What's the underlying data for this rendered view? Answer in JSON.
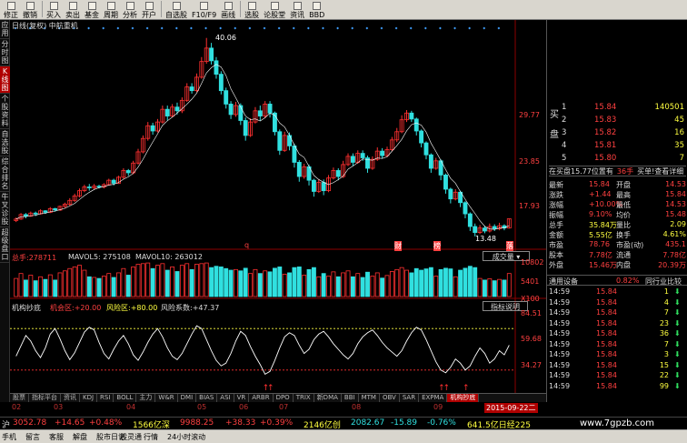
{
  "toolbar": [
    "修正",
    "撤销",
    "买入",
    "卖出",
    "基金",
    "周期",
    "分析",
    "开户",
    "自选股",
    "F10/F9",
    "画线",
    "选股",
    "论股堂",
    "资讯",
    "BBD"
  ],
  "sidebar": [
    "应用",
    "分时图",
    "K线图",
    "个股资料",
    "自选股",
    "综合排名",
    "牛叉诊股",
    "超级盘口"
  ],
  "chart": {
    "title": "日线(复权)",
    "stock": "中航重机",
    "price_labels": [
      "29.77",
      "23.85",
      "17.93"
    ],
    "max_label": "40.06",
    "min_label": "13.48",
    "events": [
      "q",
      "财",
      "榜",
      "落"
    ],
    "volume_label": "总手:278711",
    "mavol5": "MAVOL5: 275108",
    "mavol10": "MAVOL10: 263012",
    "chip_tab": "成交量",
    "vol_axis": [
      "10802",
      "5401",
      "X100"
    ],
    "ind_name": "机构抄底",
    "ind_p1": "机会区:+20.00",
    "ind_p2": "风险区:+80.00",
    "ind_p3": "风险系数:+47.37",
    "ind_btn": "指标说明",
    "ind_axis": [
      "84.51",
      "59.68",
      "34.27"
    ],
    "months": [
      "02",
      "03",
      "04",
      "05",
      "06",
      "07",
      "08",
      "09"
    ],
    "date_box": "2015-09-22二"
  },
  "tabs": [
    "股票",
    "指标平台",
    "资讯",
    "KDJ",
    "RSI",
    "BOLL",
    "主力",
    "W&R",
    "DMI",
    "BIAS",
    "ASI",
    "VR",
    "ARBR",
    "DPO",
    "TRIX",
    "新DMA",
    "BBI",
    "MTM",
    "OBV",
    "SAR",
    "EXPMA",
    "机构抄底"
  ],
  "orderbook": {
    "sell_tag": "卖",
    "buy_tag": "买",
    "sell_label": "盘",
    "asks": [
      {
        "n": "1",
        "p": "15.84",
        "v": "140501"
      },
      {
        "n": "2",
        "p": "15.83",
        "v": "45"
      },
      {
        "n": "3",
        "p": "15.82",
        "v": "16"
      },
      {
        "n": "4",
        "p": "15.81",
        "v": "35"
      },
      {
        "n": "5",
        "p": "15.80",
        "v": "7"
      }
    ],
    "note": "在买盘15.77位置有",
    "note_v": "36手",
    "note_link": "买单!查看详细"
  },
  "stats": [
    [
      "最新",
      "15.84",
      "开盘",
      "14.53"
    ],
    [
      "涨跌",
      "+1.44",
      "最高",
      "15.84"
    ],
    [
      "涨幅",
      "+10.00%",
      "最低",
      "14.53"
    ],
    [
      "振幅",
      "9.10%",
      "均价",
      "15.48"
    ],
    [
      "总手",
      "35.84万",
      "量比",
      "2.09"
    ],
    [
      "金额",
      "5.55亿",
      "换手",
      "4.61%"
    ],
    [
      "市盈",
      "78.76",
      "市盈(动)",
      "435.1"
    ],
    [
      "股本",
      "7.78亿",
      "流通",
      "7.78亿"
    ],
    [
      "外盘",
      "15.46万",
      "内盘",
      "20.39万"
    ]
  ],
  "tabs2": {
    "a": "通用设备",
    "b": "0.82%",
    "c": "同行业比较"
  },
  "trades": [
    [
      "14:59",
      "15.84",
      "1"
    ],
    [
      "14:59",
      "15.84",
      "4"
    ],
    [
      "14:59",
      "15.84",
      "7"
    ],
    [
      "14:59",
      "15.84",
      "23"
    ],
    [
      "14:59",
      "15.84",
      "36"
    ],
    [
      "14:59",
      "15.84",
      "7"
    ],
    [
      "14:59",
      "15.84",
      "3"
    ],
    [
      "14:59",
      "15.84",
      "15"
    ],
    [
      "14:59",
      "15.84",
      "22"
    ],
    [
      "14:59",
      "15.84",
      "99"
    ]
  ],
  "index": {
    "a": "沪",
    "b": "3052.78",
    "c": "+14.65",
    "d": "+0.48%",
    "e": "1566亿深",
    "f": "9988.25",
    "g": "+38.33",
    "h": "+0.39%",
    "i": "2146亿创",
    "j": "2082.67",
    "k": "-15.89",
    "l": "-0.76%",
    "m": "641.5亿日经225"
  },
  "status": [
    "手机",
    "留言",
    "客服",
    "解盘",
    "股市日记",
    "股灵通",
    "行情",
    "24小时滚动"
  ],
  "watermark": "www.7gpzb.com",
  "colors": {
    "up": "#ff3030",
    "down": "#30e0e0",
    "yellow": "#ffff40"
  },
  "chart_data": {
    "type": "candlestick",
    "price_range": [
      12,
      41
    ],
    "candles": [
      [
        15.6,
        15.8,
        15.4,
        16.0
      ],
      [
        15.8,
        16.4,
        15.7,
        16.6
      ],
      [
        16.4,
        16.2,
        15.9,
        16.6
      ],
      [
        16.2,
        16.6,
        16.1,
        16.8
      ],
      [
        16.6,
        16.5,
        16.2,
        16.8
      ],
      [
        16.5,
        16.9,
        16.4,
        17.1
      ],
      [
        16.9,
        16.7,
        16.5,
        17.0
      ],
      [
        16.7,
        17.2,
        16.6,
        17.4
      ],
      [
        17.2,
        17.0,
        16.8,
        17.3
      ],
      [
        17.0,
        17.5,
        16.9,
        17.6
      ],
      [
        17.5,
        17.8,
        17.3,
        18.0
      ],
      [
        17.8,
        18.3,
        17.6,
        18.6
      ],
      [
        18.3,
        18.9,
        18.1,
        19.2
      ],
      [
        18.9,
        19.6,
        18.7,
        19.9
      ],
      [
        19.6,
        20.1,
        19.4,
        20.4
      ],
      [
        20.1,
        20.0,
        19.6,
        20.5
      ],
      [
        20.0,
        20.2,
        19.8,
        20.5
      ],
      [
        20.2,
        20.1,
        19.9,
        20.4
      ],
      [
        20.1,
        20.4,
        19.9,
        20.6
      ],
      [
        20.4,
        21.0,
        20.3,
        21.2
      ],
      [
        21.0,
        20.6,
        20.3,
        21.2
      ],
      [
        20.6,
        21.4,
        20.5,
        21.6
      ],
      [
        21.4,
        22.3,
        21.2,
        22.6
      ],
      [
        22.3,
        22.0,
        21.6,
        22.5
      ],
      [
        22.0,
        23.3,
        21.8,
        23.6
      ],
      [
        23.3,
        24.8,
        23.1,
        25.2
      ],
      [
        24.8,
        26.6,
        24.6,
        27.0
      ],
      [
        26.6,
        28.3,
        26.3,
        28.8
      ],
      [
        28.3,
        27.6,
        27.1,
        28.7
      ],
      [
        27.6,
        28.8,
        27.4,
        29.2
      ],
      [
        28.8,
        30.5,
        28.6,
        31.0
      ],
      [
        30.5,
        29.6,
        29.0,
        31.0
      ],
      [
        29.6,
        30.8,
        29.4,
        31.2
      ],
      [
        30.8,
        30.3,
        29.8,
        31.4
      ],
      [
        30.3,
        31.7,
        30.0,
        32.1
      ],
      [
        31.7,
        33.5,
        31.5,
        34.0
      ],
      [
        33.5,
        33.0,
        32.6,
        34.0
      ],
      [
        33.0,
        34.8,
        32.8,
        35.3
      ],
      [
        34.8,
        36.9,
        34.6,
        37.5
      ],
      [
        36.9,
        38.7,
        36.6,
        40.06
      ],
      [
        38.7,
        37.0,
        36.5,
        39.4
      ],
      [
        37.0,
        35.2,
        34.6,
        37.5
      ],
      [
        35.2,
        33.0,
        32.5,
        35.6
      ],
      [
        33.0,
        31.2,
        30.6,
        33.4
      ],
      [
        31.2,
        29.8,
        29.2,
        31.6
      ],
      [
        29.8,
        31.0,
        29.5,
        31.5
      ],
      [
        31.0,
        29.0,
        28.4,
        31.3
      ],
      [
        29.0,
        27.0,
        26.3,
        29.4
      ],
      [
        27.0,
        28.8,
        26.8,
        29.3
      ],
      [
        28.8,
        30.3,
        28.6,
        30.8
      ],
      [
        30.3,
        29.6,
        29.0,
        31.0
      ],
      [
        29.6,
        31.2,
        29.3,
        31.6
      ],
      [
        31.2,
        30.0,
        29.4,
        31.6
      ],
      [
        30.0,
        27.5,
        27.0,
        30.2
      ],
      [
        27.5,
        25.0,
        24.4,
        27.8
      ],
      [
        25.0,
        27.0,
        24.8,
        27.5
      ],
      [
        27.0,
        25.6,
        25.0,
        27.4
      ],
      [
        25.6,
        23.4,
        22.7,
        25.9
      ],
      [
        23.4,
        21.5,
        20.8,
        23.7
      ],
      [
        21.5,
        22.8,
        21.2,
        23.2
      ],
      [
        22.8,
        21.0,
        20.3,
        23.1
      ],
      [
        21.0,
        19.5,
        18.8,
        21.2
      ],
      [
        19.5,
        20.7,
        19.3,
        21.1
      ],
      [
        20.7,
        19.6,
        19.0,
        21.1
      ],
      [
        19.6,
        21.3,
        19.4,
        21.7
      ],
      [
        21.3,
        22.3,
        21.1,
        22.7
      ],
      [
        22.3,
        21.5,
        21.0,
        22.6
      ],
      [
        21.5,
        23.1,
        21.3,
        23.6
      ],
      [
        23.1,
        24.2,
        22.9,
        24.6
      ],
      [
        24.2,
        23.4,
        22.9,
        24.6
      ],
      [
        23.4,
        24.6,
        23.2,
        25.0
      ],
      [
        24.6,
        24.0,
        23.6,
        25.0
      ],
      [
        24.0,
        22.6,
        22.0,
        24.3
      ],
      [
        22.6,
        23.8,
        22.4,
        24.2
      ],
      [
        23.8,
        24.9,
        23.6,
        25.4
      ],
      [
        24.9,
        24.3,
        23.9,
        25.3
      ],
      [
        24.3,
        25.1,
        24.1,
        25.5
      ],
      [
        25.1,
        26.4,
        24.9,
        26.8
      ],
      [
        26.4,
        27.5,
        26.1,
        28.0
      ],
      [
        27.5,
        29.1,
        27.3,
        29.7
      ],
      [
        29.1,
        30.0,
        28.8,
        30.4
      ],
      [
        30.0,
        29.2,
        28.8,
        30.3
      ],
      [
        29.2,
        27.6,
        27.0,
        29.4
      ],
      [
        27.6,
        26.0,
        25.4,
        27.8
      ],
      [
        26.0,
        24.4,
        23.8,
        26.2
      ],
      [
        24.4,
        22.6,
        22.0,
        24.6
      ],
      [
        22.6,
        23.6,
        22.4,
        24.0
      ],
      [
        23.6,
        21.7,
        21.0,
        23.8
      ],
      [
        21.7,
        19.8,
        19.2,
        21.9
      ],
      [
        19.8,
        18.5,
        17.9,
        20.0
      ],
      [
        18.5,
        19.4,
        18.3,
        19.8
      ],
      [
        19.4,
        18.0,
        17.4,
        19.6
      ],
      [
        18.0,
        16.5,
        15.9,
        18.2
      ],
      [
        16.5,
        14.8,
        14.2,
        16.7
      ],
      [
        14.8,
        14.0,
        13.48,
        15.2
      ],
      [
        14.0,
        14.6,
        13.8,
        15.0
      ],
      [
        14.6,
        14.2,
        13.9,
        14.9
      ],
      [
        14.2,
        14.8,
        14.0,
        15.2
      ],
      [
        14.8,
        14.5,
        14.2,
        15.1
      ],
      [
        14.5,
        14.9,
        14.3,
        15.3
      ],
      [
        14.9,
        14.6,
        14.3,
        15.1
      ],
      [
        14.6,
        15.84,
        14.53,
        15.84
      ]
    ],
    "volume": [
      55,
      70,
      50,
      65,
      48,
      60,
      52,
      66,
      50,
      72,
      78,
      85,
      90,
      95,
      80,
      60,
      58,
      55,
      62,
      70,
      58,
      72,
      85,
      65,
      90,
      98,
      100,
      102,
      85,
      95,
      100,
      80,
      90,
      76,
      95,
      100,
      82,
      98,
      100,
      102,
      88,
      92,
      90,
      85,
      80,
      82,
      78,
      86,
      70,
      82,
      70,
      78,
      75,
      86,
      90,
      68,
      72,
      88,
      90,
      65,
      82,
      88,
      60,
      70,
      62,
      75,
      60,
      72,
      78,
      60,
      70,
      58,
      74,
      62,
      72,
      56,
      64,
      76,
      82,
      88,
      80,
      72,
      85,
      80,
      84,
      88,
      62,
      82,
      86,
      84,
      60,
      80,
      86,
      92,
      88,
      55,
      50,
      54,
      48,
      52,
      50,
      70
    ],
    "indicator": [
      40,
      55,
      70,
      62,
      48,
      38,
      52,
      72,
      80,
      65,
      48,
      35,
      45,
      60,
      75,
      82,
      78,
      60,
      44,
      36,
      50,
      62,
      70,
      58,
      42,
      34,
      46,
      60,
      72,
      80,
      68,
      52,
      40,
      35,
      44,
      58,
      72,
      84,
      80,
      64,
      48,
      34,
      26,
      30,
      44,
      62,
      76,
      70,
      54,
      40,
      28,
      14,
      18,
      34,
      52,
      68,
      74,
      70,
      56,
      44,
      50,
      64,
      72,
      76,
      68,
      58,
      50,
      42,
      36,
      44,
      58,
      68,
      74,
      78,
      70,
      60,
      52,
      46,
      40,
      48,
      62,
      74,
      82,
      78,
      64,
      48,
      32,
      20,
      16,
      24,
      36,
      30,
      20,
      26,
      40,
      52,
      44,
      30,
      36,
      48,
      42,
      56
    ]
  }
}
